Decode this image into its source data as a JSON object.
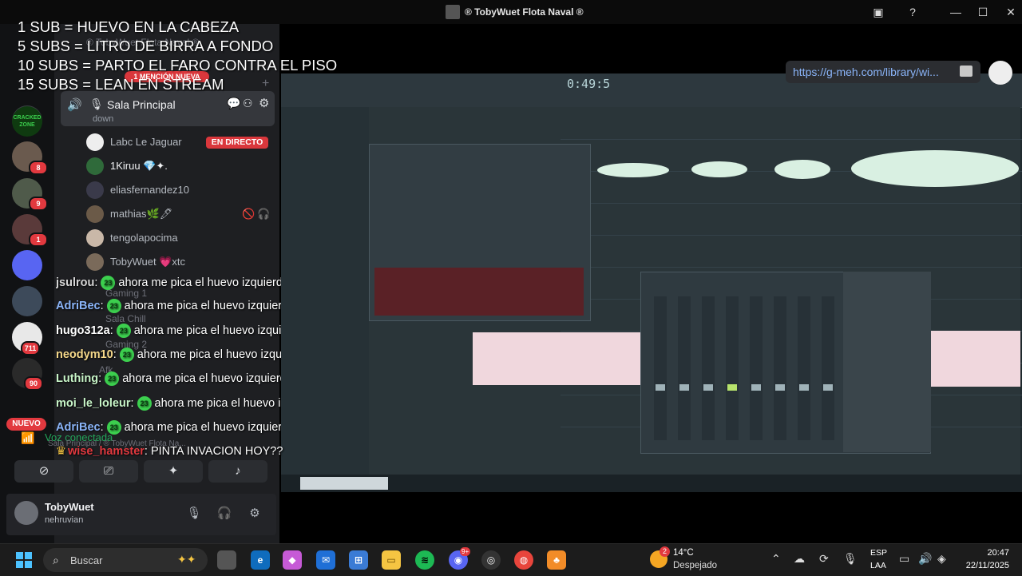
{
  "window": {
    "title": "® TobyWuet Flota Naval ®",
    "minimize": "—",
    "maximize": "☐",
    "close": "✕"
  },
  "overlay": {
    "lines": [
      "1 SUB = HUEVO EN LA CABEZA",
      "5 SUBS = LITRO DE BIRRA A FONDO",
      "10 SUBS = PARTO EL FARO CONTRA EL PISO",
      "15 SUBS = LEAN EN STREAM"
    ]
  },
  "servers": {
    "badges": [
      "1",
      "8",
      "9",
      "1",
      "711",
      "90"
    ],
    "new_label": "NUEVO",
    "cracked_label": "CRACKED ZONE"
  },
  "sidebar": {
    "server_name": "® TobyWuet Flota Naval ®",
    "mention_pill": "1 MENCIÓN NUEVA",
    "voice_channel": "Sala Principal",
    "voice_sub": "down",
    "live_badge": "EN DIRECTO",
    "users": [
      {
        "name": "Labc Le Jaguar"
      },
      {
        "name": "1Kiruu 💎✦."
      },
      {
        "name": "eliasfernandez10"
      },
      {
        "name": "mathias🌿🖊"
      },
      {
        "name": "tengolapocima"
      },
      {
        "name": "TobyWuet 💗xtc"
      }
    ],
    "ghost_channels": [
      "Gaming 1",
      "Sala Chill",
      "Gaming 2",
      "Afk"
    ]
  },
  "chat": {
    "emote_text": "23",
    "messages": [
      {
        "user": "jsulrou",
        "color": "#d6d6d6",
        "text": "ahora me pica el huevo izquierdo c"
      },
      {
        "user": "AdriBec",
        "color": "#8ab4f8",
        "text": "ahora me pica el huevo izquierdo c"
      },
      {
        "user": "hugo312a",
        "color": "#ffffff",
        "text": "ahora me pica el huevo izquierd"
      },
      {
        "user": "neodym10",
        "color": "#f5d88a",
        "text": "ahora me pica el huevo izquierc"
      },
      {
        "user": "Luthing",
        "color": "#c8f5c8",
        "text": "ahora me pica el huevo izquierdo c"
      },
      {
        "user": "moi_le_loleur",
        "color": "#c8f5c8",
        "text": "ahora me pica el huevo izqui"
      },
      {
        "user": "AdriBec",
        "color": "#8ab4f8",
        "text": "ahora me pica el huevo izquierdo c"
      },
      {
        "user": "wise_hamster",
        "color": "#e2393f",
        "text": "PINTA INVACION HOY??"
      }
    ]
  },
  "voice_panel": {
    "status": "Voz conectada",
    "path": "Sala Principal / ® TobyWuet Flota Na..."
  },
  "user_panel": {
    "name": "TobyWuet",
    "tag": "nehruvian"
  },
  "stream": {
    "url": "https://g-meh.com/library/wi...",
    "fl_time": "0:49:5"
  },
  "taskbar": {
    "search_placeholder": "Buscar",
    "weather_temp": "14°C",
    "weather_desc": "Despejado",
    "weather_badge": "2",
    "discord_badge": "9+",
    "lang_top": "ESP",
    "lang_bottom": "LAA",
    "time": "20:47",
    "date": "22/11/2025"
  }
}
